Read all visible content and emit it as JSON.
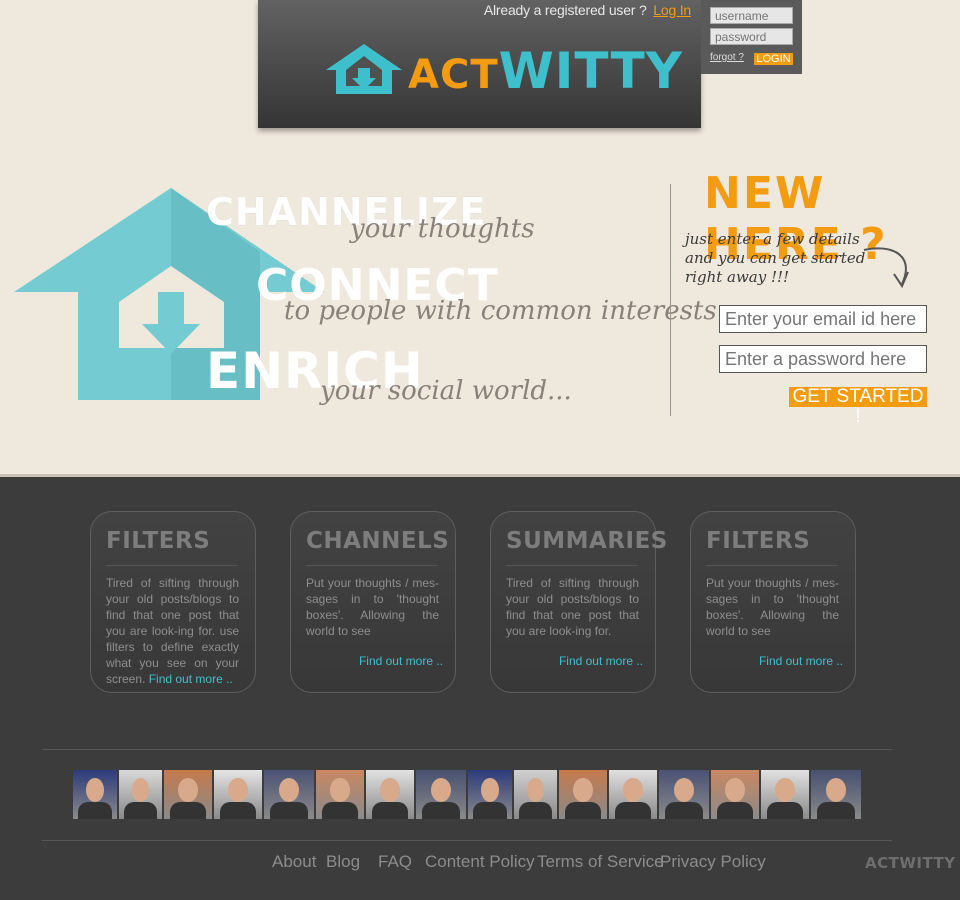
{
  "header": {
    "already_text": "Already a registered user ?",
    "login_link": "Log In",
    "logo_act": "ACT",
    "logo_witty": "WITTY"
  },
  "login": {
    "username_placeholder": "username",
    "password_placeholder": "password",
    "forgot": "forgot ?",
    "login_button": "LOGIN"
  },
  "hero": {
    "channelize": "CHANNELIZE",
    "channelize_sub": "your thoughts",
    "connect": "CONNECT",
    "connect_sub": "to people with common interests",
    "enrich": "ENRICH",
    "enrich_sub": "your social world..."
  },
  "signup": {
    "title": "NEW HERE ?",
    "instruction": "just enter a few details and you can get started right away !!!",
    "email_placeholder": "Enter your email id here",
    "password_placeholder": "Enter a password here",
    "button": "GET STARTED !"
  },
  "cards": [
    {
      "title": "FILTERS",
      "body": "Tired of sifting through your old posts/blogs to find that one post that you are look-ing for. use filters to define exactly what you see on your screen.",
      "more": "Find out more .."
    },
    {
      "title": "CHANNELS",
      "body": "Put your thoughts / mes-sages in to 'thought boxes'. Allowing the world to see",
      "more": "Find out more .."
    },
    {
      "title": "SUMMARIES",
      "body": "Tired of sifting through your old posts/blogs to find that one post that you are look-ing for.",
      "more": "Find out more .."
    },
    {
      "title": "FILTERS",
      "body": "Put your thoughts / mes-sages in to 'thought boxes'. Allowing the world to see",
      "more": "Find out more .."
    }
  ],
  "faces": [
    "#2d3b7c",
    "#d8d8d8",
    "#c57a4c",
    "#e4e4e4",
    "#4b5375",
    "#c98862",
    "#e1e1e1",
    "#465070",
    "#2d3b7c",
    "#d0d0d0",
    "#c57a4c",
    "#e0e0e0",
    "#4a5274",
    "#c98862",
    "#e1e1e1",
    "#465070"
  ],
  "footer": {
    "links": [
      "About",
      "Blog",
      "FAQ",
      "Content Policy",
      "Terms of Service",
      "Privacy Policy"
    ],
    "logo": "ACTWITTY"
  }
}
